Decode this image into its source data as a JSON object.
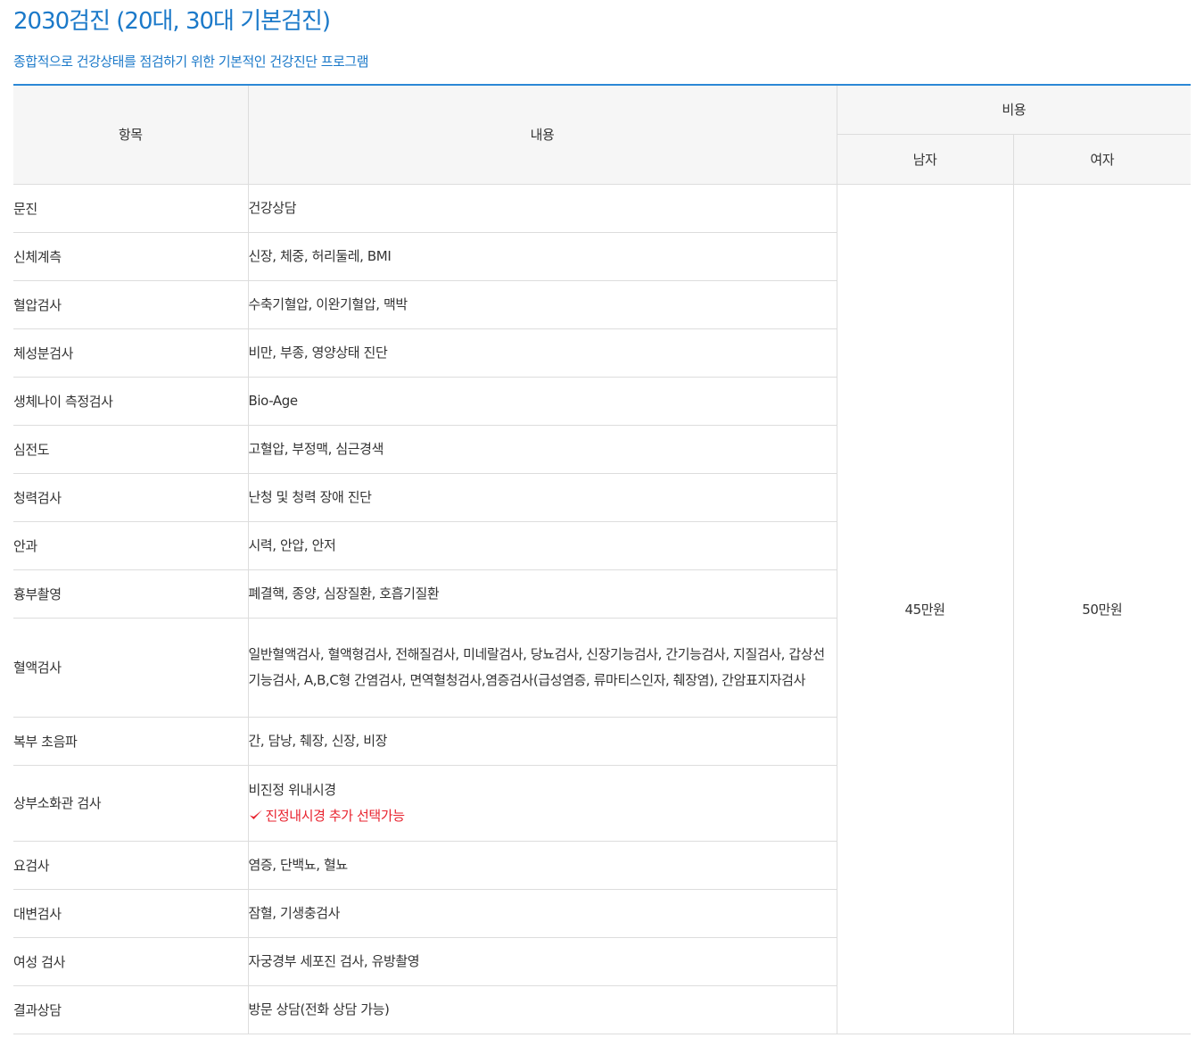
{
  "header": {
    "title": "2030검진 (20대, 30대 기본검진)",
    "subtitle": "종합적으로 건강상태를 점검하기 위한 기본적인 건강진단 프로그램"
  },
  "table": {
    "headers": {
      "item": "항목",
      "content": "내용",
      "cost": "비용",
      "male": "남자",
      "female": "여자"
    },
    "prices": {
      "male": "45만원",
      "female": "50만원"
    },
    "rows": [
      {
        "item": "문진",
        "content": "건강상담"
      },
      {
        "item": "신체계측",
        "content": "신장, 체중, 허리둘레, BMI"
      },
      {
        "item": "혈압검사",
        "content": "수축기혈압, 이완기혈압, 맥박"
      },
      {
        "item": "체성분검사",
        "content": "비만, 부종, 영양상태 진단"
      },
      {
        "item": "생체나이 측정검사",
        "content": "Bio-Age"
      },
      {
        "item": "심전도",
        "content": "고혈압, 부정맥, 심근경색"
      },
      {
        "item": "청력검사",
        "content": "난청 및 청력 장애 진단"
      },
      {
        "item": "안과",
        "content": "시력, 안압, 안저"
      },
      {
        "item": "흉부촬영",
        "content": "폐결핵, 종양, 심장질환, 호흡기질환"
      },
      {
        "item": "혈액검사",
        "content": "일반혈액검사, 혈액형검사, 전해질검사, 미네랄검사, 당뇨검사, 신장기능검사, 간기능검사, 지질검사, 갑상선기능검사, A,B,C형 간염검사, 면역혈청검사,염증검사(급성염증, 류마티스인자, 췌장염), 간암표지자검사"
      },
      {
        "item": "복부 초음파",
        "content": "간, 담낭, 췌장, 신장, 비장"
      },
      {
        "item": "상부소화관 검사",
        "content": "비진정 위내시경",
        "note": "진정내시경 추가 선택가능"
      },
      {
        "item": "요검사",
        "content": "염증, 단백뇨, 혈뇨"
      },
      {
        "item": "대변검사",
        "content": "잠혈, 기생충검사"
      },
      {
        "item": "여성 검사",
        "content": "자궁경부 세포진 검사, 유방촬영"
      },
      {
        "item": "결과상담",
        "content": "방문 상담(전화 상담 가능)"
      }
    ]
  },
  "colors": {
    "accent": "#1b79c9",
    "header_bg": "#f6f6f6",
    "note": "#e8232f"
  },
  "icons": {
    "note_icon": "checkmark-icon"
  }
}
